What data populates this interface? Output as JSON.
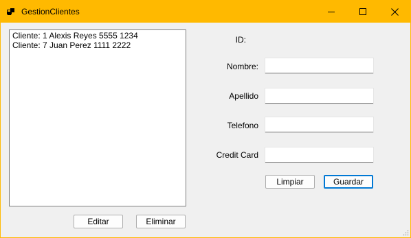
{
  "window": {
    "title": "GestionClientes",
    "accent_color": "#ffb900",
    "icons": [
      "app-icon",
      "minimize-icon",
      "maximize-icon",
      "close-icon"
    ]
  },
  "clients_list": {
    "items": [
      "Cliente: 1 Alexis Reyes 5555 1234",
      "Cliente: 7 Juan Perez 1111 2222"
    ]
  },
  "list_buttons": {
    "edit_label": "Editar",
    "delete_label": "Eliminar"
  },
  "form": {
    "id_label": "ID:",
    "id_value": "",
    "nombre_label": "Nombre:",
    "nombre_value": "",
    "apellido_label": "Apellido",
    "apellido_value": "",
    "telefono_label": "Telefono",
    "telefono_value": "",
    "credit_card_label": "Credit Card",
    "credit_card_value": "",
    "clear_label": "Limpiar",
    "save_label": "Guardar"
  }
}
